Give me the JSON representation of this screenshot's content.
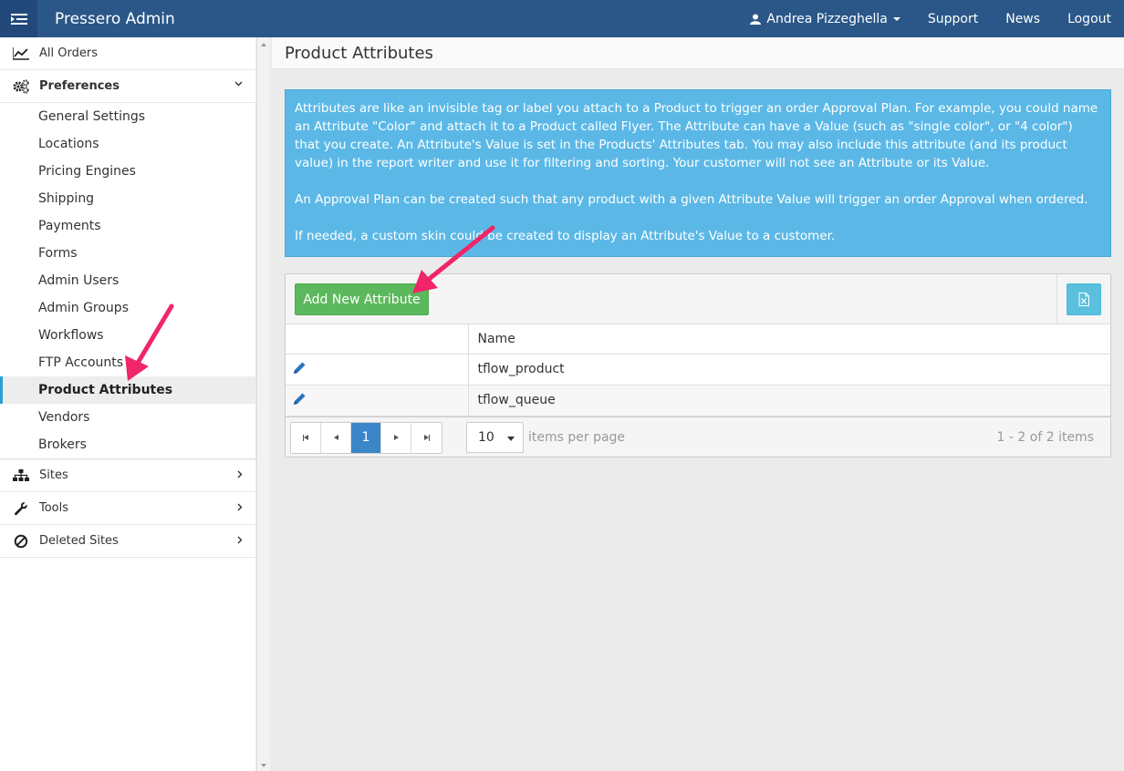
{
  "app": {
    "title": "Pressero Admin"
  },
  "topnav": {
    "user": "Andrea Pizzeghella",
    "support": "Support",
    "news": "News",
    "logout": "Logout"
  },
  "sidebar": {
    "all_orders": "All Orders",
    "preferences": "Preferences",
    "preferences_items": [
      "General Settings",
      "Locations",
      "Pricing Engines",
      "Shipping",
      "Payments",
      "Forms",
      "Admin Users",
      "Admin Groups",
      "Workflows",
      "FTP Accounts",
      "Product Attributes",
      "Vendors",
      "Brokers"
    ],
    "active_item": "Product Attributes",
    "sites": "Sites",
    "tools": "Tools",
    "deleted_sites": "Deleted Sites"
  },
  "main": {
    "page_title": "Product Attributes",
    "info": [
      "Attributes are like an invisible tag or label you attach to a Product to trigger an order Approval Plan. For example, you could name an Attribute \"Color\" and attach it to a Product called Flyer. The Attribute can have a Value (such as \"single color\", or \"4 color\") that you create. An Attribute's Value is set in the Products' Attributes tab. You may also include this attribute (and its product value) in the report writer and use it for filtering and sorting. Your customer will not see an Attribute or its Value.",
      "An Approval Plan can be created such that any product with a given Attribute Value will trigger an order Approval when ordered.",
      "If needed, a custom skin could be created to display an Attribute's Value to a customer."
    ],
    "add_button": "Add New Attribute",
    "grid": {
      "columns": [
        "",
        "Name"
      ],
      "rows": [
        {
          "name": "tflow_product"
        },
        {
          "name": "tflow_queue"
        }
      ]
    },
    "pager": {
      "current_page": "1",
      "page_size": "10",
      "items_per_page_label": "items per page",
      "summary": "1 - 2 of 2 items"
    }
  },
  "colors": {
    "topbar": "#2a5788",
    "info": "#5bb8e6",
    "add": "#5cb85c",
    "excel": "#5bc0de",
    "pager_active": "#3b86c9",
    "arrow": "#f0256a"
  }
}
